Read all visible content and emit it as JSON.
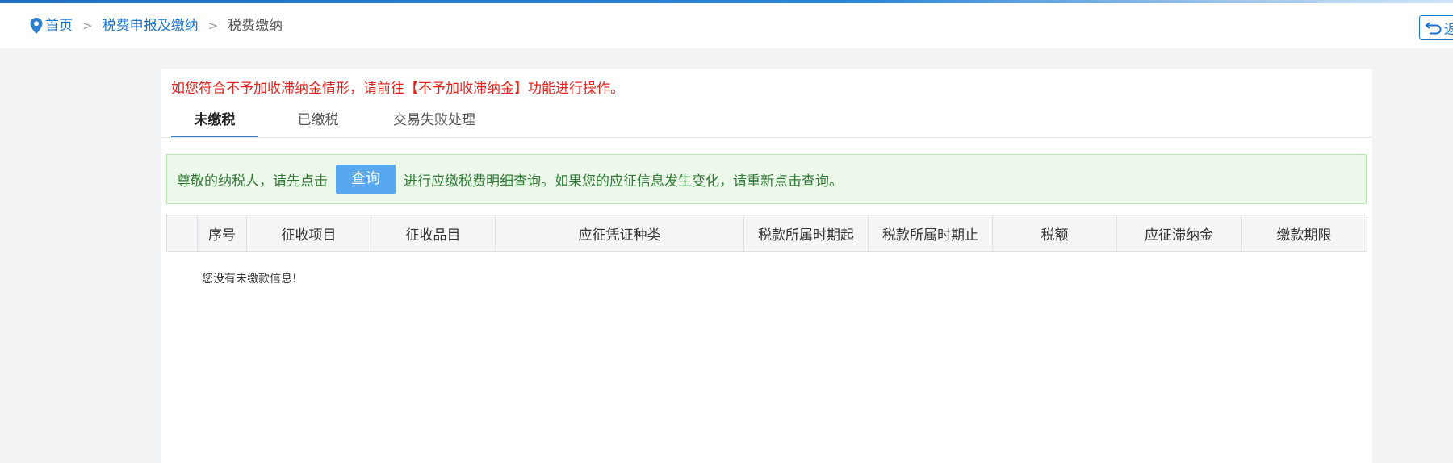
{
  "breadcrumb": {
    "home": "首页",
    "separator": ">",
    "level2": "税费申报及缴纳",
    "current": "税费缴纳"
  },
  "back_button": {
    "label": "返",
    "icon": "return-arrow-icon"
  },
  "notice": {
    "text": "如您符合不予加收滞纳金情形，请前往【不予加收滞纳金】功能进行操作。",
    "color": "#e8201b"
  },
  "tabs": [
    {
      "label": "未缴税",
      "active": true
    },
    {
      "label": "已缴税",
      "active": false
    },
    {
      "label": "交易失败处理",
      "active": false
    }
  ],
  "info_bar": {
    "text_before": "尊敬的纳税人，请先点击",
    "button_label": "查询",
    "text_after": "进行应缴税费明细查询。如果您的应征信息发生变化，请重新点击查询。"
  },
  "table": {
    "columns": [
      "",
      "序号",
      "征收项目",
      "征收品目",
      "应征凭证种类",
      "税款所属时期起",
      "税款所属时期止",
      "税额",
      "应征滞纳金",
      "缴款期限"
    ],
    "rows": [],
    "empty_message": "您没有未缴款信息!"
  },
  "colors": {
    "accent": "#1a73d1",
    "tab_underline": "#2d7fd3",
    "query_button": "#57a8ee",
    "info_bg": "#ecf8ea",
    "info_text": "#2f7a35"
  }
}
